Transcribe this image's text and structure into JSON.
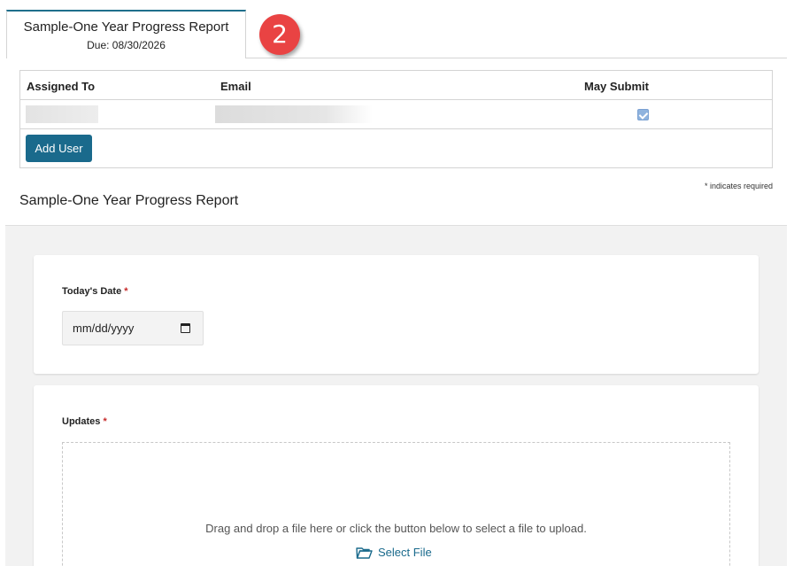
{
  "tab": {
    "title": "Sample-One Year Progress Report",
    "due": "Due: 08/30/2026"
  },
  "step_badge": "2",
  "users": {
    "headers": {
      "assigned_to": "Assigned To",
      "email": "Email",
      "may_submit": "May Submit"
    },
    "rows": [
      {
        "may_submit": true
      }
    ],
    "add_user_label": "Add User"
  },
  "required_note": "* indicates required",
  "form_title": "Sample-One Year Progress Report",
  "fields": {
    "todays_date": {
      "label": "Today's Date",
      "required_mark": "*",
      "placeholder": "mm/dd/yyyy"
    },
    "updates": {
      "label": "Updates",
      "required_mark": "*",
      "drop_text": "Drag and drop a file here or click the button below to select a file to upload.",
      "select_label": "Select File"
    }
  },
  "colors": {
    "accent": "#1a6a8c",
    "required": "#c62828",
    "badge": "#e94343"
  }
}
